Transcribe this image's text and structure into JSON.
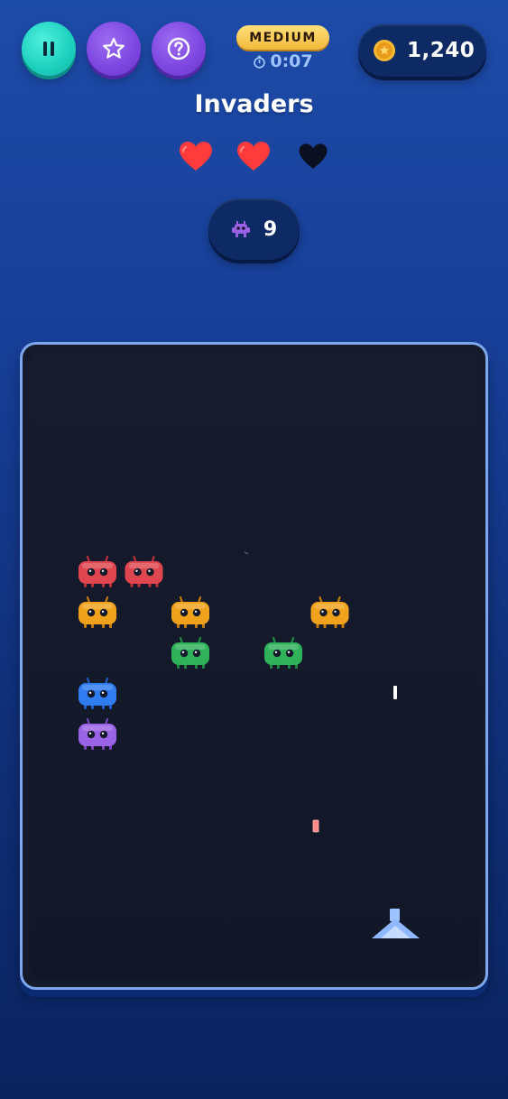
{
  "header": {
    "difficulty": "MEDIUM",
    "timer": "0:07",
    "coins": "1,240"
  },
  "game": {
    "title": "Invaders",
    "lives": {
      "current": 2,
      "max": 3
    },
    "enemies_remaining": "9"
  },
  "icons": {
    "pause": "pause-icon",
    "favorite": "star-icon",
    "help": "question-icon",
    "coin": "coin-icon",
    "timer": "stopwatch-icon",
    "enemy": "alien-monster-icon",
    "heart_full": "heart-icon",
    "heart_empty": "heart-empty-icon"
  },
  "colors": {
    "pause_button": "#1ccfbd",
    "menu_buttons": "#7c45e0",
    "difficulty_badge": "#f2b93b",
    "heart_full": "#ff3b3b",
    "heart_empty": "#0b1020",
    "playfield_border": "#7fa7ee",
    "playfield_bg": "#141a2a",
    "player_ship": "#a6c9ff",
    "alien_red": "#e0464f",
    "alien_orange": "#f0a21c",
    "alien_green": "#2fb25a",
    "alien_blue": "#2f7bf0",
    "alien_purple": "#9a62e4"
  },
  "aliens": [
    {
      "row": 0,
      "col": 0,
      "color": "red"
    },
    {
      "row": 0,
      "col": 1,
      "color": "red"
    },
    {
      "row": 1,
      "col": 0,
      "color": "orange"
    },
    {
      "row": 1,
      "col": 2,
      "color": "orange"
    },
    {
      "row": 1,
      "col": 5,
      "color": "orange"
    },
    {
      "row": 2,
      "col": 2,
      "color": "green"
    },
    {
      "row": 2,
      "col": 4,
      "color": "green"
    },
    {
      "row": 3,
      "col": 0,
      "color": "blue"
    },
    {
      "row": 4,
      "col": 0,
      "color": "purple"
    }
  ]
}
